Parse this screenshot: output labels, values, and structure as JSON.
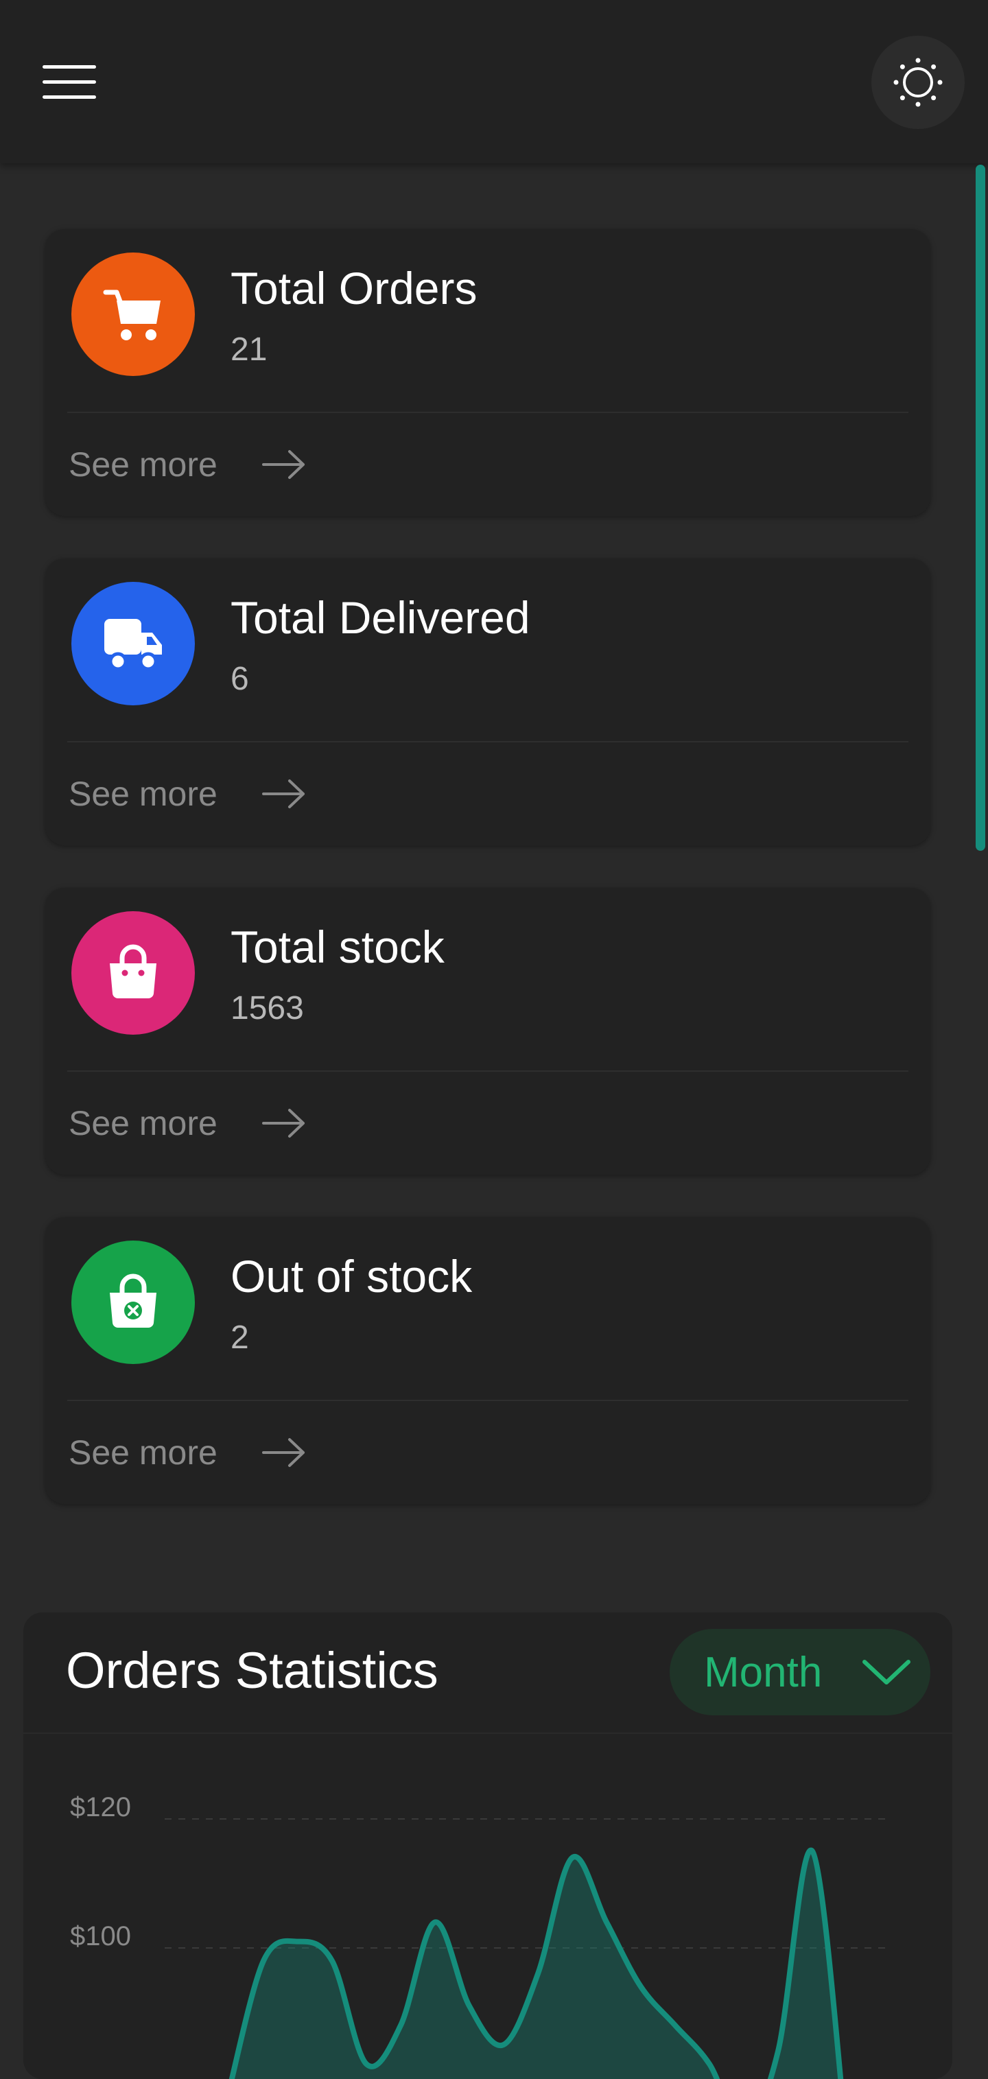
{
  "header": {
    "menu_icon": "hamburger-icon",
    "theme_icon": "sun-icon"
  },
  "cards": [
    {
      "title": "Total Orders",
      "value": "21",
      "link": "See more",
      "icon": "cart-icon",
      "color": "#ec5a11"
    },
    {
      "title": "Total Delivered",
      "value": "6",
      "link": "See more",
      "icon": "truck-icon",
      "color": "#2563eb"
    },
    {
      "title": "Total stock",
      "value": "1563",
      "link": "See more",
      "icon": "shopping-bag-icon",
      "color": "#db2777"
    },
    {
      "title": "Out of stock",
      "value": "2",
      "link": "See more",
      "icon": "bag-x-icon",
      "color": "#16a34a"
    }
  ],
  "stats": {
    "title": "Orders Statistics",
    "period": "Month",
    "y_labels": [
      "$120",
      "$100"
    ],
    "accent": "#158d7c"
  },
  "chart_data": {
    "type": "area",
    "y_ticks": [
      120,
      100
    ],
    "values": [
      78,
      98,
      101,
      98,
      82,
      88,
      104,
      91,
      85,
      96,
      114,
      104,
      94,
      88,
      82,
      72,
      84,
      115,
      70
    ]
  }
}
